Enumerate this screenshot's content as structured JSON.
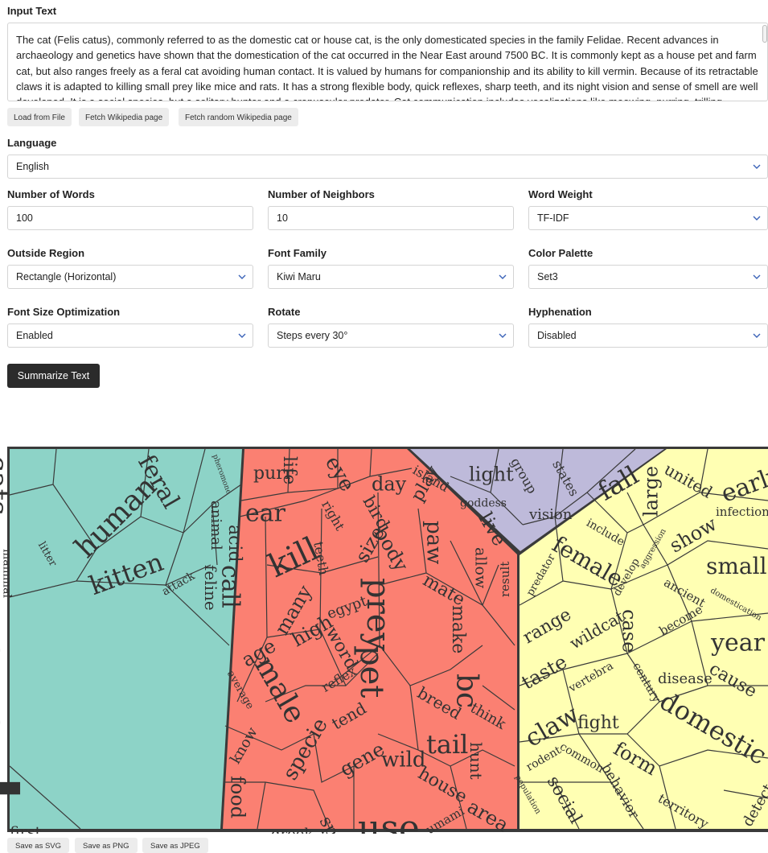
{
  "input": {
    "label": "Input Text",
    "value": "The cat (Felis catus), commonly referred to as the domestic cat or house cat, is the only domesticated species in the family Felidae. Recent advances in archaeology and genetics have shown that the domestication of the cat occurred in the Near East around 7500 BC. It is commonly kept as a house pet and farm cat, but also ranges freely as a feral cat avoiding human contact. It is valued by humans for companionship and its ability to kill vermin. Because of its retractable claws it is adapted to killing small prey like mice and rats. It has a strong flexible body, quick reflexes, sharp teeth, and its night vision and sense of smell are well developed. It is a social species, but a solitary hunter and a crepuscular predator. Cat communication includes vocalizations like meowing, purring, trilling, hissing, growling, and grunting as"
  },
  "loaders": {
    "file": "Load from File",
    "wiki": "Fetch Wikipedia page",
    "random": "Fetch random Wikipedia page"
  },
  "language": {
    "label": "Language",
    "value": "English"
  },
  "num_words": {
    "label": "Number of Words",
    "value": "100"
  },
  "num_neighbors": {
    "label": "Number of Neighbors",
    "value": "10"
  },
  "word_weight": {
    "label": "Word Weight",
    "value": "TF-IDF"
  },
  "outside_region": {
    "label": "Outside Region",
    "value": "Rectangle (Horizontal)"
  },
  "font_family": {
    "label": "Font Family",
    "value": "Kiwi Maru"
  },
  "color_palette": {
    "label": "Color Palette",
    "value": "Set3"
  },
  "font_size_opt": {
    "label": "Font Size Optimization",
    "value": "Enabled"
  },
  "rotate": {
    "label": "Rotate",
    "value": "Steps every 30°"
  },
  "hyphenation": {
    "label": "Hyphenation",
    "value": "Disabled"
  },
  "summarize": {
    "label": "Summarize Text"
  },
  "save": {
    "svg": "Save as SVG",
    "png": "Save as PNG",
    "jpeg": "Save as JPEG"
  },
  "colors": {
    "teal": "#8dd3c7",
    "red": "#fb8072",
    "purple": "#bebada",
    "yellow": "#ffffb3",
    "border": "#3a3a3a"
  },
  "cloud": {
    "words": [
      "cats",
      "human",
      "feral",
      "pheromone",
      "mammal",
      "litter",
      "kitten",
      "animal",
      "attack",
      "feline",
      "cat",
      "first",
      "purr",
      "life",
      "eye",
      "day",
      "ear",
      "kill",
      "right",
      "bird",
      "play",
      "acid",
      "call",
      "teeth",
      "size",
      "body",
      "paw",
      "allow",
      "many",
      "egypt",
      "prey",
      "mate",
      "result",
      "age",
      "high",
      "word",
      "make",
      "male",
      "average",
      "reflex",
      "pet",
      "breed",
      "bc",
      "tend",
      "think",
      "know",
      "specie",
      "gene",
      "wild",
      "tail",
      "hunt",
      "food",
      "spay",
      "use",
      "house",
      "area",
      "greek",
      "umami",
      "island",
      "light",
      "group",
      "states",
      "fall",
      "goddess",
      "live",
      "vision",
      "united",
      "early",
      "large",
      "infection",
      "include",
      "show",
      "predator",
      "female",
      "aggression",
      "small",
      "ancient",
      "domestication",
      "range",
      "develop",
      "wildcat",
      "become",
      "year",
      "taste",
      "case",
      "vertebra",
      "disease",
      "cause",
      "century",
      "claw",
      "fight",
      "domestic",
      "form",
      "rodent",
      "common",
      "behavior",
      "detect",
      "population",
      "social",
      "territory"
    ]
  }
}
